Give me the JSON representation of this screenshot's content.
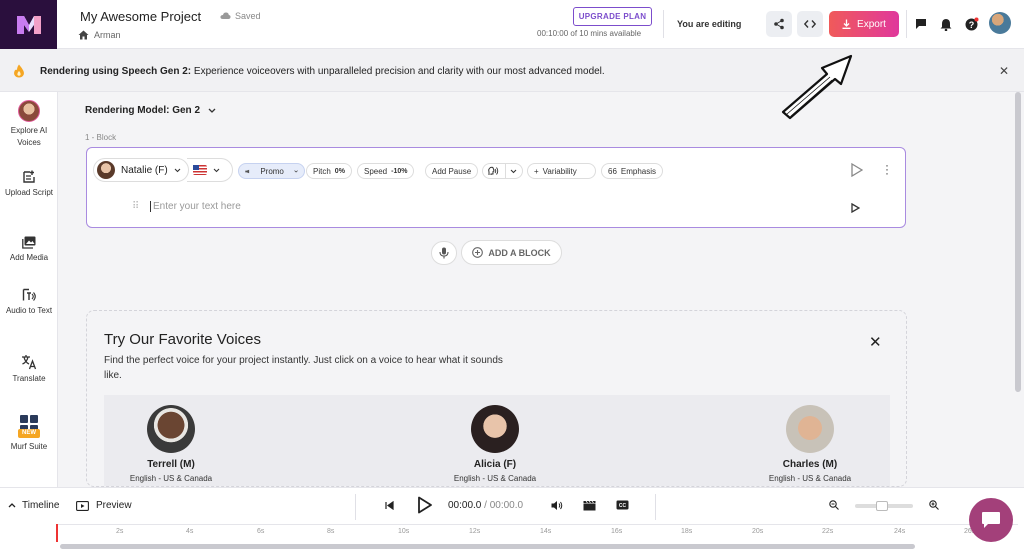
{
  "header": {
    "project_title": "My Awesome Project",
    "saved_status": "Saved",
    "breadcrumb": "Arman",
    "upgrade_label": "UPGRADE PLAN",
    "minutes_used": "00:10:00 of 10 mins available",
    "editing_status": "You are editing",
    "export_label": "Export",
    "accent_color": "#e84a80"
  },
  "banner": {
    "bold_text": "Rendering using Speech Gen 2:",
    "text": " Experience voiceovers with unparalleled precision and clarity with our most advanced model."
  },
  "sidebar": {
    "items": [
      {
        "label": "Explore AI Voices",
        "icon": "voices-avatar-icon"
      },
      {
        "label": "Upload Script",
        "icon": "upload-script-icon"
      },
      {
        "label": "Add Media",
        "icon": "media-icon"
      },
      {
        "label": "Audio to Text",
        "icon": "audio-text-icon"
      },
      {
        "label": "Translate",
        "icon": "translate-icon"
      },
      {
        "label": "Murf Suite",
        "icon": "grid-icon",
        "badge": "NEW"
      }
    ]
  },
  "editor": {
    "rendering_model": "Rendering Model: Gen 2",
    "block_label": "1 -   Block",
    "voice_name": "Natalie (F)",
    "style": "Promo",
    "pitch_label": "Pitch",
    "pitch_value": "0%",
    "speed_label": "Speed",
    "speed_value": "-10%",
    "add_pause": "Add Pause",
    "variability": "Variability",
    "emphasis": "Emphasis",
    "text_placeholder": "Enter your text here",
    "add_block": "ADD A BLOCK"
  },
  "favorites": {
    "title": "Try Our Favorite Voices",
    "description": "Find the perfect voice for your project instantly. Just click on a voice to hear what it sounds like.",
    "voices": [
      {
        "name": "Terrell (M)",
        "lang": "English - US & Canada"
      },
      {
        "name": "Alicia (F)",
        "lang": "English - US & Canada"
      },
      {
        "name": "Charles (M)",
        "lang": "English - US & Canada"
      }
    ]
  },
  "timeline": {
    "label": "Timeline",
    "preview": "Preview",
    "current_time": "00:00.0",
    "total_time": "/ 00:00.0",
    "ticks": [
      "2s",
      "4s",
      "6s",
      "8s",
      "10s",
      "12s",
      "14s",
      "16s",
      "18s",
      "20s",
      "22s",
      "24s",
      "26s"
    ]
  }
}
